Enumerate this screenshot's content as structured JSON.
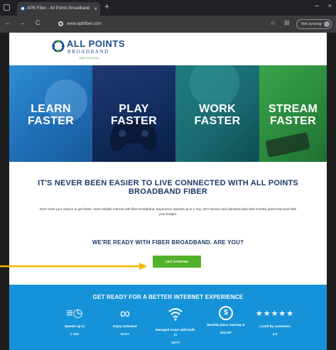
{
  "browser": {
    "tab_title": "APB Fiber - All Points Broadband",
    "tab_close": "×",
    "new_tab": "+",
    "minimize": "–",
    "close": "×",
    "back": "←",
    "forward": "→",
    "reload": "C",
    "url": "www.apbfiber.com",
    "star": "☆",
    "collections": "⊞",
    "sync_label": "Not syncing"
  },
  "logo": {
    "name": "ALL POINTS",
    "sub": "BROADBAND",
    "tagline": "Stay Connected"
  },
  "hero": {
    "panels": [
      {
        "line1": "LEARN",
        "line2": "FASTER"
      },
      {
        "line1": "PLAY",
        "line2": "FASTER"
      },
      {
        "line1": "WORK",
        "line2": "FASTER"
      },
      {
        "line1": "STREAM",
        "line2": "FASTER"
      }
    ]
  },
  "main": {
    "headline": "IT'S NEVER BEEN EASIER TO LIVE CONNECTED WITH ALL POINTS BROADBAND FIBER",
    "blurb": "Don't miss your chance to get faster, more reliable internet with fiber broadband. Experience speeds up to 1 Gig, 24/7 service and unlimited data with monthly plans that work with your budget.",
    "ready": "WE'RE READY WITH FIBER BROADBAND. ARE YOU?",
    "cta": "GET STARTED"
  },
  "band": {
    "title": "GET READY FOR A BETTER INTERNET EXPERIENCE",
    "features": [
      {
        "icon": "speed-icon",
        "glyph": "≡◷",
        "label": "Speeds up to",
        "value": "1 GIG"
      },
      {
        "icon": "infinity-icon",
        "glyph": "∞",
        "label": "Enjoy unlimited",
        "value": "DATA"
      },
      {
        "icon": "wifi-icon",
        "glyph": "◠",
        "label": "Managed router with built-in",
        "value": "WI-FI"
      },
      {
        "icon": "dollar-icon",
        "glyph": "$",
        "label": "Monthly plans starting at",
        "value": "$29.99*"
      },
      {
        "icon": "stars-icon",
        "glyph": "★★★★★",
        "label": "Loved by customers",
        "value": "4.6"
      }
    ]
  },
  "colors": {
    "brand_blue": "#1b4c8f",
    "brand_green": "#52b12a",
    "band_blue": "#1693d8",
    "annotation_yellow": "#f5b800"
  }
}
